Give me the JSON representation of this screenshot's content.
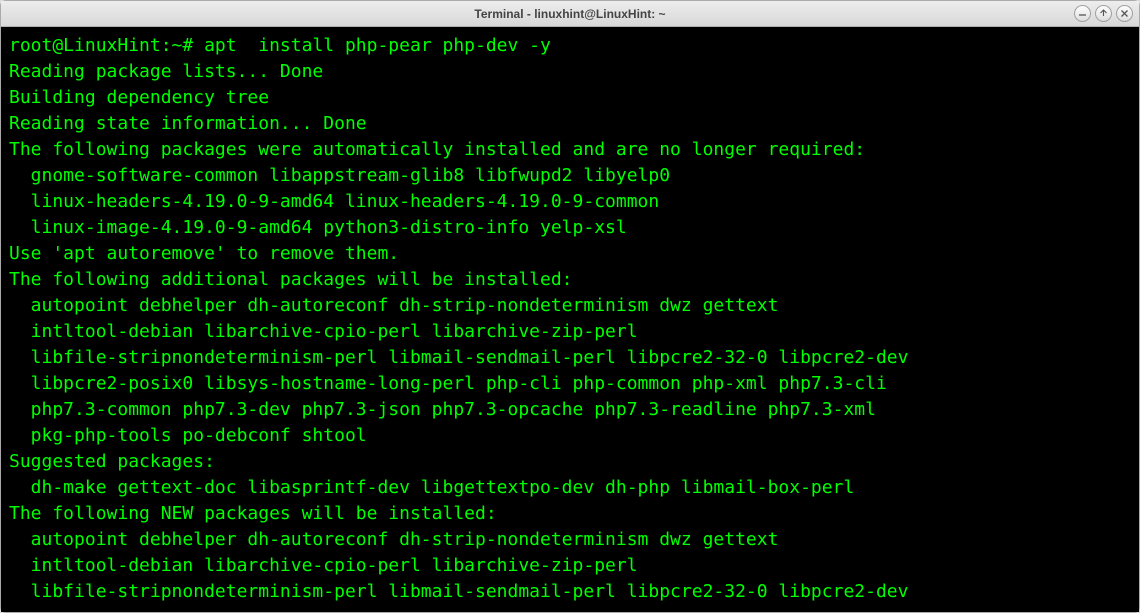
{
  "window": {
    "title": "Terminal - linuxhint@LinuxHint: ~"
  },
  "terminal": {
    "prompt": "root@LinuxHint:~# ",
    "command": "apt  install php-pear php-dev -y",
    "output_lines": [
      "Reading package lists... Done",
      "Building dependency tree",
      "Reading state information... Done",
      "The following packages were automatically installed and are no longer required:",
      "  gnome-software-common libappstream-glib8 libfwupd2 libyelp0",
      "  linux-headers-4.19.0-9-amd64 linux-headers-4.19.0-9-common",
      "  linux-image-4.19.0-9-amd64 python3-distro-info yelp-xsl",
      "Use 'apt autoremove' to remove them.",
      "The following additional packages will be installed:",
      "  autopoint debhelper dh-autoreconf dh-strip-nondeterminism dwz gettext",
      "  intltool-debian libarchive-cpio-perl libarchive-zip-perl",
      "  libfile-stripnondeterminism-perl libmail-sendmail-perl libpcre2-32-0 libpcre2-dev",
      "  libpcre2-posix0 libsys-hostname-long-perl php-cli php-common php-xml php7.3-cli",
      "  php7.3-common php7.3-dev php7.3-json php7.3-opcache php7.3-readline php7.3-xml",
      "  pkg-php-tools po-debconf shtool",
      "Suggested packages:",
      "  dh-make gettext-doc libasprintf-dev libgettextpo-dev dh-php libmail-box-perl",
      "The following NEW packages will be installed:",
      "  autopoint debhelper dh-autoreconf dh-strip-nondeterminism dwz gettext",
      "  intltool-debian libarchive-cpio-perl libarchive-zip-perl",
      "  libfile-stripnondeterminism-perl libmail-sendmail-perl libpcre2-32-0 libpcre2-dev"
    ]
  }
}
